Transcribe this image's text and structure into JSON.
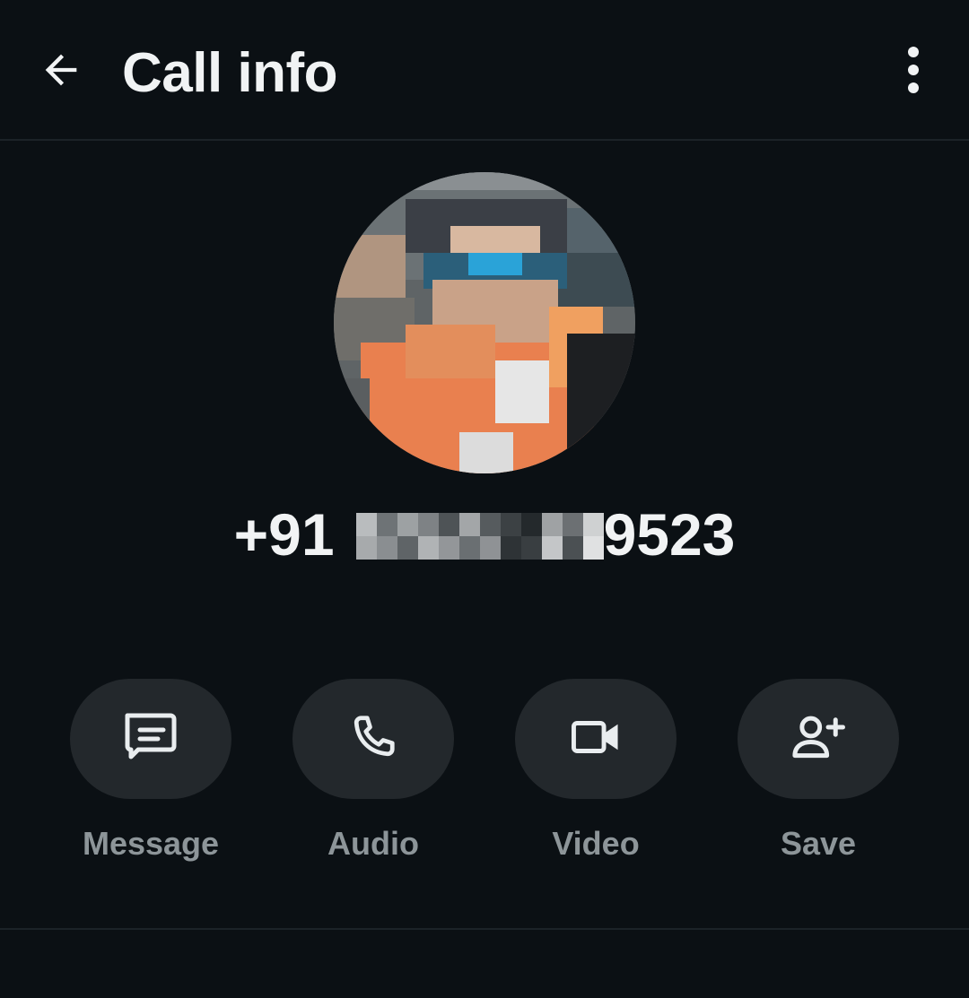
{
  "header": {
    "title": "Call info",
    "back_icon": "arrow-left-icon",
    "menu_icon": "more-vertical-icon"
  },
  "contact": {
    "country_code": "+91",
    "number_visible_suffix": "9523",
    "avatar_icon": "profile-photo-pixelated"
  },
  "actions": [
    {
      "label": "Message",
      "icon": "message-icon"
    },
    {
      "label": "Audio",
      "icon": "phone-icon"
    },
    {
      "label": "Video",
      "icon": "video-icon"
    },
    {
      "label": "Save",
      "icon": "add-person-icon"
    }
  ],
  "colors": {
    "background": "#0b1014",
    "text_primary": "#f1f3f4",
    "text_secondary": "#8d9599",
    "pill": "#23282c",
    "divider": "#1c2328"
  }
}
